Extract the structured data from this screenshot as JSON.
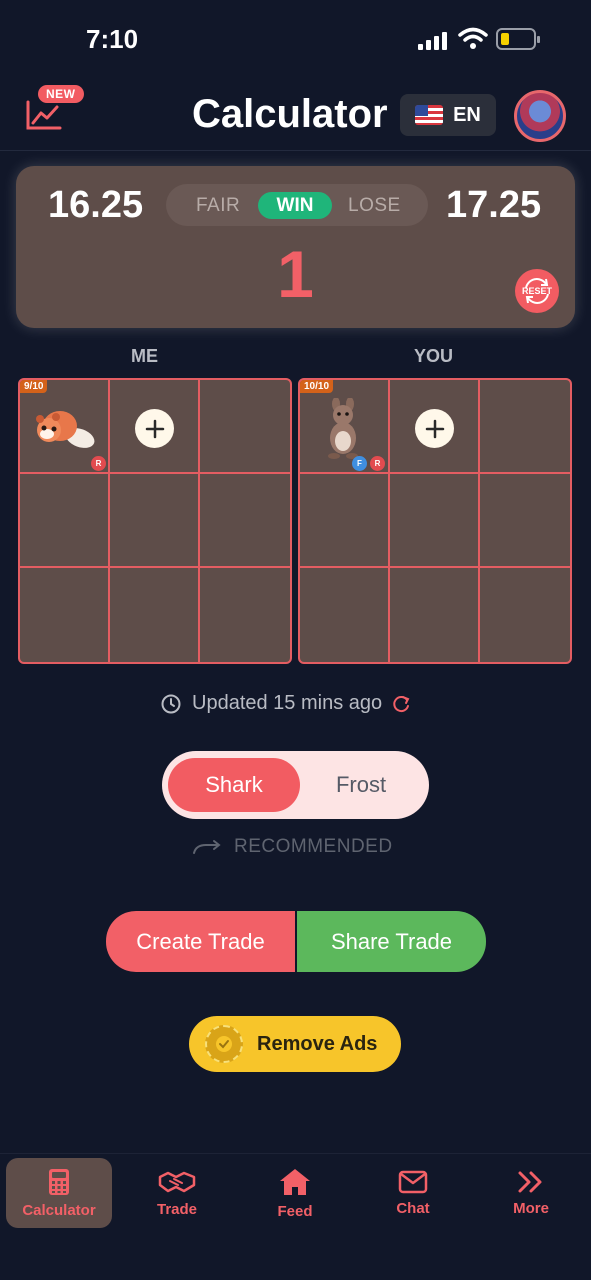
{
  "status_bar": {
    "time": "7:10"
  },
  "header": {
    "new_badge": "NEW",
    "title": "Calculator",
    "language": {
      "flag": "us-flag",
      "label": "EN"
    }
  },
  "score": {
    "left_value": "16.25",
    "right_value": "17.25",
    "options": [
      "FAIR",
      "WIN",
      "LOSE"
    ],
    "selected": "WIN",
    "result": "1",
    "reset_label": "RESET"
  },
  "sides": {
    "me": {
      "label": "ME",
      "count": "9/10",
      "pet_tags": [
        "R"
      ]
    },
    "you": {
      "label": "YOU",
      "count": "10/10",
      "pet_tags": [
        "F",
        "R"
      ]
    }
  },
  "updated": {
    "text": "Updated 15 mins ago"
  },
  "mode_toggle": {
    "options": [
      "Shark",
      "Frost"
    ],
    "selected": "Shark",
    "recommended_label": "RECOMMENDED"
  },
  "actions": {
    "create_trade": "Create Trade",
    "share_trade": "Share Trade",
    "remove_ads": "Remove Ads"
  },
  "bottom_nav": [
    {
      "label": "Calculator",
      "icon": "calculator-icon",
      "active": true
    },
    {
      "label": "Trade",
      "icon": "handshake-icon",
      "active": false
    },
    {
      "label": "Feed",
      "icon": "home-icon",
      "active": false
    },
    {
      "label": "Chat",
      "icon": "mail-icon",
      "active": false
    },
    {
      "label": "More",
      "icon": "double-chevron-icon",
      "active": false
    }
  ],
  "colors": {
    "background": "#111729",
    "accent_red": "#f26067",
    "win_green": "#1fb57a",
    "share_green": "#5cb85c",
    "card_brown": "#5e4d49",
    "ads_yellow": "#f7c52a"
  }
}
